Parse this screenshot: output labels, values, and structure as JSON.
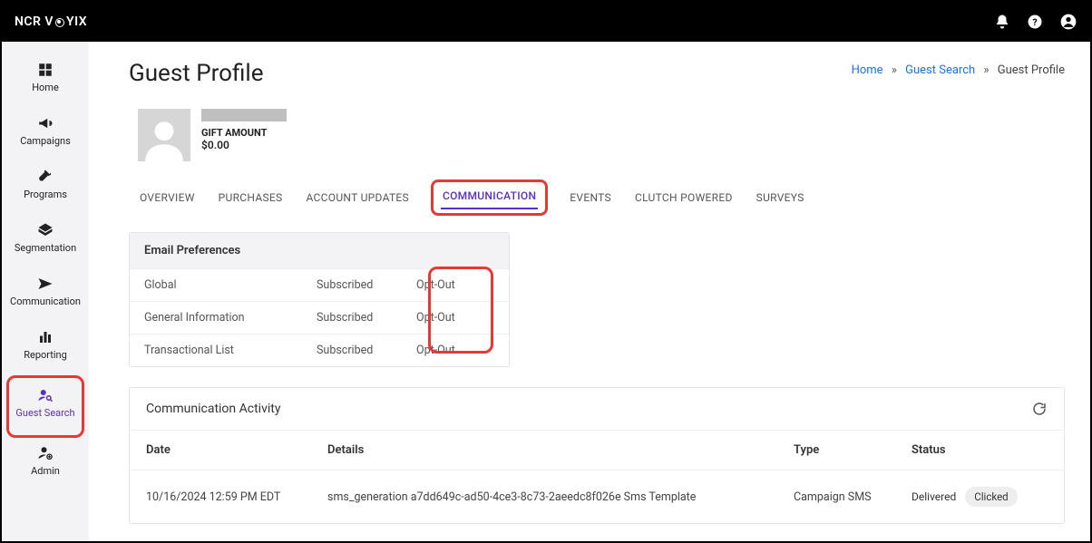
{
  "brand": "NCR V   YIX",
  "breadcrumb": {
    "home": "Home",
    "search": "Guest Search",
    "current": "Guest Profile"
  },
  "page_title": "Guest Profile",
  "sidebar": {
    "items": [
      {
        "label": "Home"
      },
      {
        "label": "Campaigns"
      },
      {
        "label": "Programs"
      },
      {
        "label": "Segmentation"
      },
      {
        "label": "Communication"
      },
      {
        "label": "Reporting"
      },
      {
        "label": "Guest Search"
      },
      {
        "label": "Admin"
      }
    ]
  },
  "profile": {
    "gift_label": "GIFT AMOUNT",
    "gift_amount": "$0.00"
  },
  "tabs": [
    {
      "label": "OVERVIEW"
    },
    {
      "label": "PURCHASES"
    },
    {
      "label": "ACCOUNT UPDATES"
    },
    {
      "label": "COMMUNICATION",
      "active": true
    },
    {
      "label": "EVENTS"
    },
    {
      "label": "CLUTCH POWERED"
    },
    {
      "label": "SURVEYS"
    }
  ],
  "prefs": {
    "title": "Email Preferences",
    "rows": [
      {
        "name": "Global",
        "status": "Subscribed",
        "action": "Opt-Out"
      },
      {
        "name": "General Information",
        "status": "Subscribed",
        "action": "Opt-Out"
      },
      {
        "name": "Transactional List",
        "status": "Subscribed",
        "action": "Opt-Out"
      }
    ]
  },
  "activity": {
    "title": "Communication Activity",
    "headers": {
      "date": "Date",
      "details": "Details",
      "type": "Type",
      "status": "Status"
    },
    "rows": [
      {
        "date": "10/16/2024 12:59 PM EDT",
        "details": "sms_generation a7dd649c-ad50-4ce3-8c73-2aeedc8f026e Sms Template",
        "type": "Campaign SMS",
        "status_text": "Delivered",
        "status_pill": "Clicked"
      }
    ]
  }
}
